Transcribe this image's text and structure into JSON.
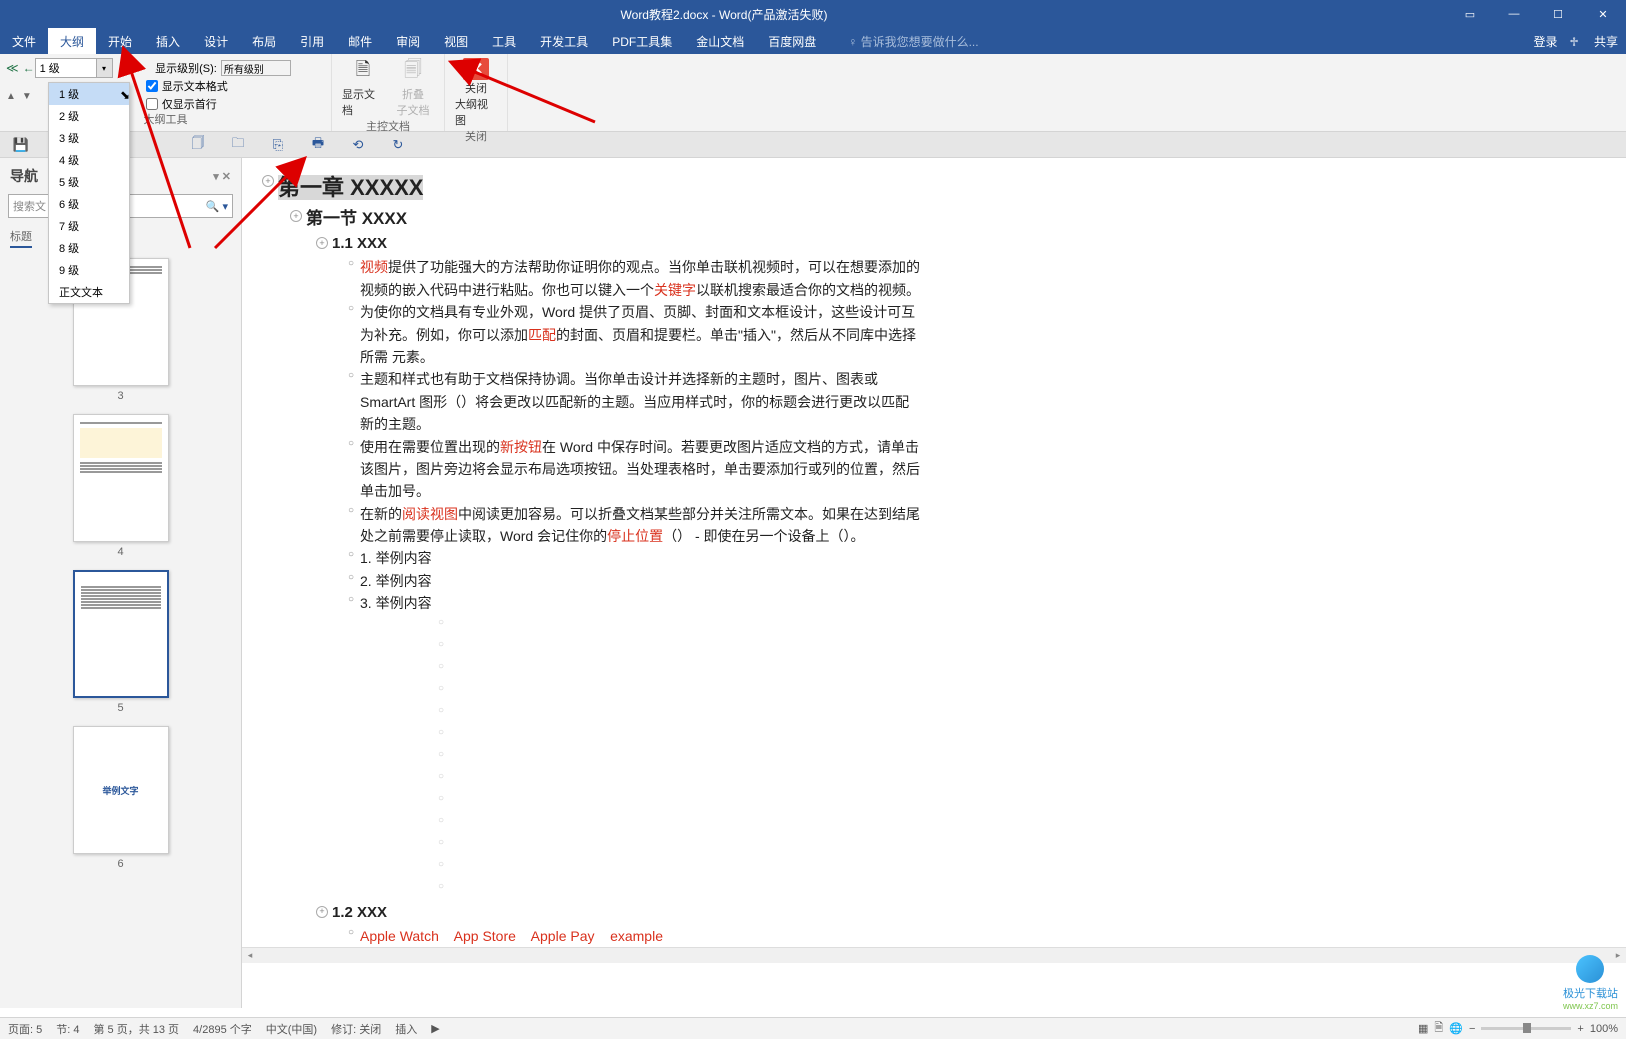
{
  "titlebar": {
    "title": "Word教程2.docx - Word(产品激活失败)"
  },
  "menu": {
    "file": "文件",
    "outline": "大纲",
    "home": "开始",
    "insert": "插入",
    "design": "设计",
    "layout": "布局",
    "references": "引用",
    "mailings": "邮件",
    "review": "审阅",
    "view": "视图",
    "tools": "工具",
    "devtools": "开发工具",
    "pdftools": "PDF工具集",
    "jinshan": "金山文档",
    "baidupan": "百度网盘",
    "help_placeholder": "告诉我您想要做什么...",
    "login": "登录",
    "share": "共享"
  },
  "ribbon": {
    "level_selected": "1 级",
    "show_level_label": "显示级别(S):",
    "show_level_value": "所有级别",
    "show_formatting": "显示文本格式",
    "show_firstline": "仅显示首行",
    "group_outline": "大纲工具",
    "show_document": "显示文档",
    "collapse_sub": "折叠",
    "collapse_sub2": "子文档",
    "group_master": "主控文档",
    "close_outline1": "关闭",
    "close_outline2": "大纲视图",
    "group_close": "关闭"
  },
  "dropdown": {
    "items": [
      "1 级",
      "2 级",
      "3 级",
      "4 级",
      "5 级",
      "6 级",
      "7 级",
      "8 级",
      "9 级",
      "正文文本"
    ]
  },
  "nav": {
    "title": "导航",
    "search_placeholder": "搜索文",
    "tab_headings": "标题",
    "thumbs": [
      {
        "num": "3"
      },
      {
        "num": "4"
      },
      {
        "num": "5",
        "selected": true
      },
      {
        "num": "6",
        "title_text": "举例文字"
      }
    ]
  },
  "doc": {
    "h1": "第一章 XXXXX",
    "h2": "第一节 XXXX",
    "h3a": "1.1 XXX",
    "p1_red1": "视频",
    "p1_rest": "提供了功能强大的方法帮助你证明你的观点。当你单击联机视频时，可以在想要添加的视频的嵌入代码中进行粘贴。你也可以键入一个",
    "p1_red2": "关键字",
    "p1_tail": "以联机搜索最适合你的文档的视频。",
    "p2_a": "为使你的文档具有专业外观，Word 提供了页眉、页脚、封面和文本框设计，这些设计可互为补充。例如，你可以添加",
    "p2_red": "匹配",
    "p2_b": "的封面、页眉和提要栏。单击\"插入\"，然后从不同库中选择所需 元素。",
    "p3": "主题和样式也有助于文档保持协调。当你单击设计并选择新的主题时，图片、图表或 SmartArt 图形（）将会更改以匹配新的主题。当应用样式时，你的标题会进行更改以匹配新的主题。",
    "p4_a": "使用在需要位置出现的",
    "p4_red": "新按钮",
    "p4_b": "在 Word 中保存时间。若要更改图片适应文档的方式，请单击该图片，图片旁边将会显示布局选项按钮。当处理表格时，单击要添加行或列的位置，然后单击加号。",
    "p5_a": "在新的",
    "p5_red1": "阅读视图",
    "p5_b": "中阅读更加容易。可以折叠文档某些部分并关注所需文本。如果在达到结尾处之前需要停止读取，Word 会记住你的",
    "p5_red2": "停止位置",
    "p5_c": "（） - 即使在另一个设备上（）。",
    "li1": "1. 举例内容",
    "li2": "2. 举例内容",
    "li3": "3. 举例内容",
    "h3b": "1.2 XXX",
    "footer_red": "Apple Watch    App Store    Apple Pay    example"
  },
  "statusbar": {
    "page": "页面: 5",
    "section": "节: 4",
    "page_of": "第 5 页，共 13 页",
    "words": "4/2895 个字",
    "lang": "中文(中国)",
    "track": "修订: 关闭",
    "insert": "插入",
    "zoom": "100%"
  },
  "watermark": {
    "name": "极光下载站",
    "url": "www.xz7.com"
  }
}
